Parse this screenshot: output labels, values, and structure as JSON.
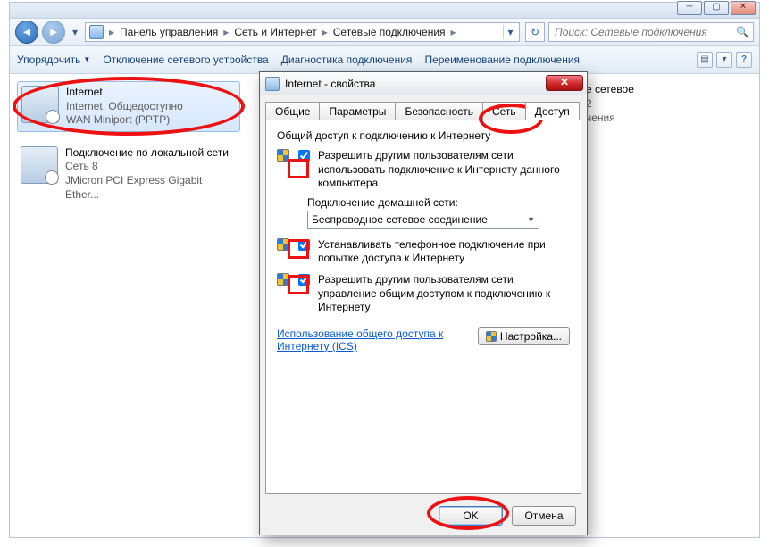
{
  "breadcrumb": {
    "items": [
      "Панель управления",
      "Сеть и Интернет",
      "Сетевые подключения"
    ]
  },
  "search": {
    "placeholder": "Поиск: Сетевые подключения"
  },
  "toolbar": {
    "organize": "Упорядочить",
    "disable": "Отключение сетевого устройства",
    "diagnose": "Диагностика подключения",
    "rename": "Переименование подключения"
  },
  "connections": {
    "internet": {
      "title": "Internet",
      "sub1": "Internet, Общедоступно",
      "sub2": "WAN Miniport (PPTP)"
    },
    "lan": {
      "title": "Подключение по локальной сети",
      "sub1": "Сеть 8",
      "sub2": "JMicron PCI Express Gigabit Ether..."
    },
    "wifi_behind": {
      "l1": "е сетевое",
      "l2": "2",
      "l3": "чения"
    }
  },
  "dialog": {
    "title": "Internet - свойства",
    "tabs": [
      "Общие",
      "Параметры",
      "Безопасность",
      "Сеть",
      "Доступ"
    ],
    "active_tab": 4,
    "group_title": "Общий доступ к подключению к Интернету",
    "opt1": "Разрешить другим пользователям сети использовать подключение к Интернету данного компьютера",
    "home_label": "Подключение домашней сети:",
    "home_value": "Беспроводное сетевое соединение",
    "opt2": "Устанавливать телефонное подключение при попытке доступа к Интернету",
    "opt3": "Разрешить другим пользователям сети управление общим доступом к подключению к Интернету",
    "link": "Использование общего доступа к Интернету (ICS)",
    "settings_btn": "Настройка...",
    "ok": "OK",
    "cancel": "Отмена",
    "cb1": true,
    "cb2": true,
    "cb3": true
  }
}
